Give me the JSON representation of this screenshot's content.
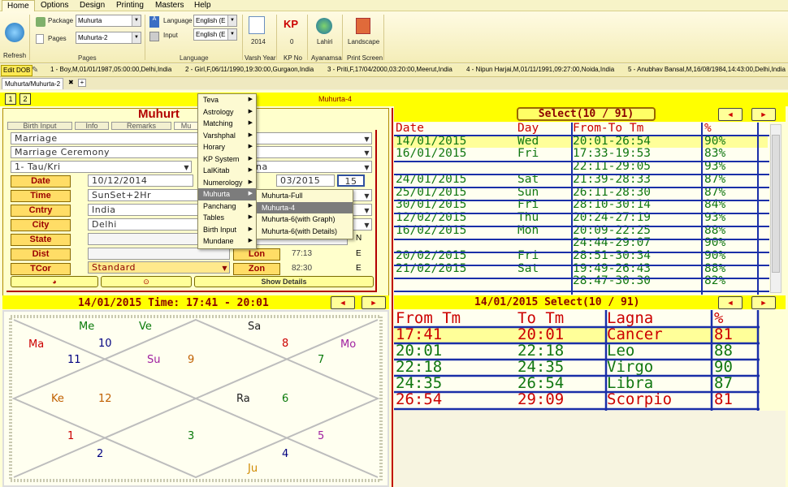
{
  "menu": {
    "tabs": [
      "Home",
      "Options",
      "Design",
      "Printing",
      "Masters",
      "Help"
    ]
  },
  "ribbon": {
    "refresh": "Refresh",
    "package_label": "Package",
    "package_value": "Muhurta",
    "pages_label": "Pages",
    "pages_value": "Muhurta-2",
    "pages_group": "Pages",
    "language_label": "Language",
    "input_label": "Input",
    "language_value": "English (E",
    "input_value": "English (E",
    "language_group": "Language",
    "varsh_year_value": "2014",
    "varsh_year_label": "Varsh Year",
    "kp_value": "0",
    "kp_label": "KP No",
    "kp_icon_text": "KP",
    "ayanamsa_value": "Lahiri",
    "ayanamsa_label": "Ayanamsa",
    "print_value": "Landscape",
    "print_label": "Print Screen"
  },
  "profiles": {
    "edit_dob": "Edit DOB",
    "items": [
      "1 - Boy,M,01/01/1987,05:00:00,Delhi,India",
      "2 - Girl,F,06/11/1990,19:30:00,Gurgaon,India",
      "3 - Priti,F,17/04/2000,03:20:00,Meerut,India",
      "4 - Nipun Harjai,M,01/11/1991,09:27:00,Noida,India",
      "5 - Anubhav Bansal,M,16/08/1984,14:43:00,Delhi,India"
    ]
  },
  "doc_tab": {
    "label": "Muhurta/Muhurta-2",
    "close": "✖",
    "add": "+"
  },
  "page_nav": {
    "p1": "1",
    "p2": "2",
    "title": "Muhurta-4"
  },
  "left": {
    "heading": "Muhurt",
    "subtabs": [
      "Birth Input",
      "Info",
      "Remarks",
      "Mu"
    ],
    "select1": "Marriage",
    "select2": "Marriage Ceremony",
    "select3": "1- Tau/Kri",
    "select3b": "na",
    "date_label": "Date",
    "date_from": "10/12/2014",
    "date_to": "03/2015",
    "date_num": "15",
    "time_label": "Time",
    "time_value": "SunSet+2Hr",
    "cntry_label": "Cntry",
    "cntry_value": "India",
    "city_label": "City",
    "city_value": "Delhi",
    "state_label": "State",
    "state_suffix": "N",
    "dist_label": "Dist",
    "lon_label": "Lon",
    "lon_value": "77:13",
    "lon_dir": "E",
    "tcor_label": "TCor",
    "tcor_value": "Standard",
    "zon_label": "Zon",
    "zon_value": "82:30",
    "zon_dir": "E",
    "show_details": "Show Details"
  },
  "context_menu": {
    "items": [
      "Teva",
      "Astrology",
      "Matching",
      "Varshphal",
      "Horary",
      "KP System",
      "LalKitab",
      "Numerology",
      "Muhurta",
      "Panchang",
      "Tables",
      "Birth Input",
      "Mundane"
    ],
    "selected": "Muhurta",
    "submenu": [
      "Muhurta-Full",
      "Muhurta-4",
      "Muhurta-6(with Graph)",
      "Muhurta-6(with Details)"
    ],
    "submenu_selected": "Muhurta-4"
  },
  "right_top": {
    "select_label": "Select(10 / 91)",
    "headers": [
      "Date",
      "Day",
      "From-To Tm",
      "%"
    ],
    "rows": [
      [
        "14/01/2015",
        "Wed",
        "20:01-26:54",
        "90%"
      ],
      [
        "16/01/2015",
        "Fri",
        "17:33-19:53",
        "83%"
      ],
      [
        "",
        "",
        "22:11-29:05",
        "93%"
      ],
      [
        "24/01/2015",
        "Sat",
        "21:39-28:33",
        "87%"
      ],
      [
        "25/01/2015",
        "Sun",
        "26:11-28:30",
        "87%"
      ],
      [
        "30/01/2015",
        "Fri",
        "28:10-30:14",
        "84%"
      ],
      [
        "12/02/2015",
        "Thu",
        "20:24-27:19",
        "93%"
      ],
      [
        "16/02/2015",
        "Mon",
        "20:09-22:25",
        "88%"
      ],
      [
        "",
        "",
        "24:44-29:07",
        "90%"
      ],
      [
        "20/02/2015",
        "Fri",
        "28:51-30:34",
        "90%"
      ],
      [
        "21/02/2015",
        "Sat",
        "19:49-26:43",
        "88%"
      ],
      [
        "",
        "",
        "28:47-30:30",
        "82%"
      ]
    ]
  },
  "chart_bar": {
    "label": "14/01/2015 Time: 17:41 - 20:01"
  },
  "right_bottom": {
    "select_label": "14/01/2015 Select(10 / 91)",
    "headers": [
      "From Tm",
      "To Tm",
      "Lagna",
      "%"
    ],
    "rows": [
      [
        "17:41",
        "20:01",
        "Cancer",
        "81"
      ],
      [
        "20:01",
        "22:18",
        "Leo",
        "88"
      ],
      [
        "22:18",
        "24:35",
        "Virgo",
        "90"
      ],
      [
        "24:35",
        "26:54",
        "Libra",
        "87"
      ],
      [
        "26:54",
        "29:09",
        "Scorpio",
        "81"
      ]
    ]
  },
  "chart": {
    "planets": [
      "Me",
      "Ve",
      "Sa",
      "Ma",
      "Mo",
      "Su",
      "Ke",
      "Ra",
      "Ju"
    ],
    "houses": [
      "10",
      "8",
      "11",
      "9",
      "7",
      "12",
      "6",
      "1",
      "3",
      "5",
      "2",
      "4"
    ]
  },
  "colors": {
    "accent": "#ffff00",
    "header_red": "#cc0000",
    "value_green": "#117711",
    "grid_blue": "#0000aa"
  }
}
